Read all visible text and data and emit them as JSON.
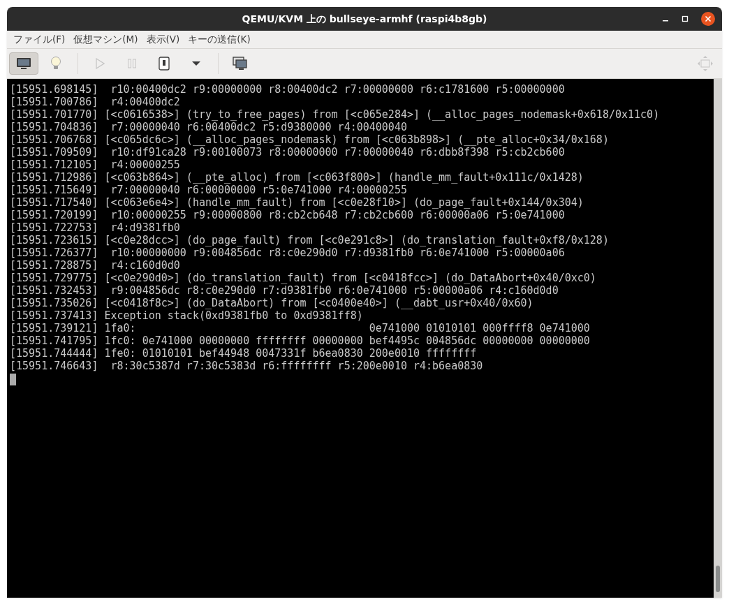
{
  "window": {
    "title": "QEMU/KVM 上の bullseye-armhf (raspi4b8gb)"
  },
  "menu": [
    "ファイル(F)",
    "仮想マシン(M)",
    "表示(V)",
    "キーの送信(K)"
  ],
  "toolbar": [
    {
      "kind": "console",
      "selected": true,
      "disabled": false
    },
    {
      "kind": "details",
      "selected": false,
      "disabled": false
    },
    {
      "kind": "separator"
    },
    {
      "kind": "run",
      "selected": false,
      "disabled": true
    },
    {
      "kind": "pause",
      "selected": false,
      "disabled": true
    },
    {
      "kind": "shutdown",
      "selected": false,
      "disabled": false
    },
    {
      "kind": "dropdown",
      "selected": false,
      "disabled": false
    },
    {
      "kind": "separator"
    },
    {
      "kind": "snapshots",
      "selected": false,
      "disabled": false
    },
    {
      "kind": "spacer"
    },
    {
      "kind": "fullscreen",
      "selected": false,
      "disabled": true
    }
  ],
  "console": {
    "lines": [
      "[15951.698145]  r10:00400dc2 r9:00000000 r8:00400dc2 r7:00000000 r6:c1781600 r5:00000000",
      "[15951.700786]  r4:00400dc2",
      "[15951.701770] [<c0616538>] (try_to_free_pages) from [<c065e284>] (__alloc_pages_nodemask+0x618/0x11c0)",
      "[15951.704836]  r7:00000040 r6:00400dc2 r5:d9380000 r4:00400040",
      "[15951.706768] [<c065dc6c>] (__alloc_pages_nodemask) from [<c063b898>] (__pte_alloc+0x34/0x168)",
      "[15951.709509]  r10:df91ca28 r9:00100073 r8:00000000 r7:00000040 r6:dbb8f398 r5:cb2cb600",
      "[15951.712105]  r4:00000255",
      "[15951.712986] [<c063b864>] (__pte_alloc) from [<c063f800>] (handle_mm_fault+0x111c/0x1428)",
      "[15951.715649]  r7:00000040 r6:00000000 r5:0e741000 r4:00000255",
      "[15951.717540] [<c063e6e4>] (handle_mm_fault) from [<c0e28f10>] (do_page_fault+0x144/0x304)",
      "[15951.720199]  r10:00000255 r9:00000800 r8:cb2cb648 r7:cb2cb600 r6:00000a06 r5:0e741000",
      "[15951.722753]  r4:d9381fb0",
      "[15951.723615] [<c0e28dcc>] (do_page_fault) from [<c0e291c8>] (do_translation_fault+0xf8/0x128)",
      "[15951.726377]  r10:00000000 r9:004856dc r8:c0e290d0 r7:d9381fb0 r6:0e741000 r5:00000a06",
      "[15951.728875]  r4:c160d0d0",
      "[15951.729775] [<c0e290d0>] (do_translation_fault) from [<c0418fcc>] (do_DataAbort+0x40/0xc0)",
      "[15951.732453]  r9:004856dc r8:c0e290d0 r7:d9381fb0 r6:0e741000 r5:00000a06 r4:c160d0d0",
      "[15951.735026] [<c0418f8c>] (do_DataAbort) from [<c0400e40>] (__dabt_usr+0x40/0x60)",
      "[15951.737413] Exception stack(0xd9381fb0 to 0xd9381ff8)",
      "[15951.739121] 1fa0:                                     0e741000 01010101 000ffff8 0e741000",
      "[15951.741795] 1fc0: 0e741000 00000000 ffffffff 00000000 bef4495c 004856dc 00000000 00000000",
      "[15951.744444] 1fe0: 01010101 bef44948 0047331f b6ea0830 200e0010 ffffffff",
      "[15951.746643]  r8:30c5387d r7:30c5383d r6:ffffffff r5:200e0010 r4:b6ea0830"
    ]
  }
}
